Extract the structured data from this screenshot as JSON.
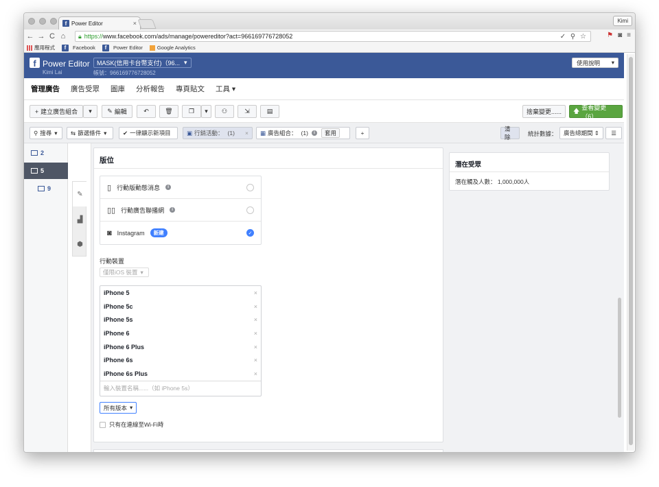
{
  "browser": {
    "tab_title": "Power Editor",
    "profile": "Kimi",
    "url_secure": "https://",
    "url_host": "www.facebook.com",
    "url_path": "/ads/manage/powereditor?act=966169776728052",
    "bookmarks": [
      {
        "label": "應用程式"
      },
      {
        "label": "Facebook"
      },
      {
        "label": "Power Editor"
      },
      {
        "label": "Google Analytics"
      }
    ]
  },
  "fb": {
    "logo": "f",
    "title": "Power Editor",
    "user": "Kimi Lai",
    "account": "MASK(信用卡台幣支付)（96...",
    "account_id": "帳號：966169776728052",
    "help": "使用說明"
  },
  "nav": {
    "items": [
      "管理廣告",
      "廣告受眾",
      "圖庫",
      "分析報告",
      "專頁貼文",
      "工具"
    ]
  },
  "actions": {
    "create": "建立廣告組合",
    "edit": "編輯",
    "discard": "捨棄變更......",
    "review": "查看變更（6）"
  },
  "filters": {
    "search": "搜尋",
    "filter": "篩選條件",
    "show_new": "一律顯示新項目",
    "campaign": "行銷活動：",
    "campaign_count": "(1)",
    "adset": "廣告組合：",
    "adset_count": "(1)",
    "apply": "套用",
    "clear": "清除",
    "stats_label": "統計數據：",
    "stats_value": "廣告總期間"
  },
  "rail": {
    "campaigns": "2",
    "adsets": "5",
    "ads": "9"
  },
  "placement": {
    "title": "版位",
    "options": [
      {
        "label": "行動版動態消息",
        "selected": false
      },
      {
        "label": "行動廣告聯播網",
        "selected": false
      },
      {
        "label": "Instagram",
        "badge": "新建",
        "selected": true
      }
    ],
    "device_label": "行動裝置",
    "device_select": "僅限iOS 裝置",
    "devices": [
      "iPhone 5",
      "iPhone 5c",
      "iPhone 5s",
      "iPhone 6",
      "iPhone 6 Plus",
      "iPhone 6s",
      "iPhone 6s Plus"
    ],
    "device_placeholder": "輸入裝置名稱......（如 iPhone 5s）",
    "versions": "所有版本",
    "wifi_only": "只有在連線至Wi-Fi時"
  },
  "audience": {
    "title": "潛在受眾",
    "reach": "潛在觸及人數： 1,000,000人"
  },
  "colors": {
    "fb_blue": "#3b5998",
    "green": "#5aa540",
    "accent": "#4080ff"
  }
}
